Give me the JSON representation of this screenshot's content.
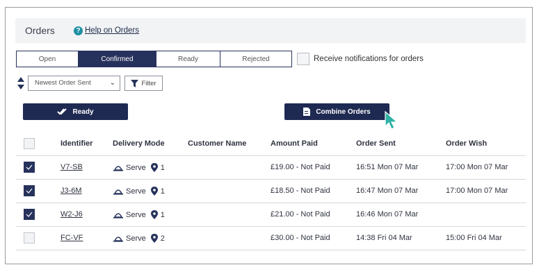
{
  "header": {
    "title": "Orders",
    "help_icon": "question-circle-icon",
    "help_link": "Help on Orders"
  },
  "tabs": [
    {
      "label": "Open",
      "active": false
    },
    {
      "label": "Confirmed",
      "active": true
    },
    {
      "label": "Ready",
      "active": false
    },
    {
      "label": "Rejected",
      "active": false
    }
  ],
  "notifications": {
    "label": "Receive notifications for orders",
    "checked": false
  },
  "sort": {
    "selected": "Newest Order Sent",
    "icon": "sort-arrows-icon"
  },
  "filter": {
    "label": "Filter",
    "icon": "funnel-icon"
  },
  "actions": {
    "ready_label": "Ready",
    "ready_icon": "double-check-icon",
    "combine_label": "Combine Orders",
    "combine_icon": "document-icon"
  },
  "table": {
    "columns": [
      "Identifier",
      "Delivery Mode",
      "Customer Name",
      "Amount Paid",
      "Order Sent",
      "Order Wish"
    ],
    "rows": [
      {
        "checked": true,
        "identifier": "V7-SB",
        "mode": "Serve",
        "table_no": "1",
        "customer": "",
        "amount": "£19.00 - Not Paid",
        "sent": "16:51 Mon 07 Mar",
        "wish": "17:00 Mon 07 Mar"
      },
      {
        "checked": true,
        "identifier": "J3-6M",
        "mode": "Serve",
        "table_no": "1",
        "customer": "",
        "amount": "£18.50 - Not Paid",
        "sent": "16:47 Mon 07 Mar",
        "wish": "17:00 Mon 07 Mar"
      },
      {
        "checked": true,
        "identifier": "W2-J6",
        "mode": "Serve",
        "table_no": "1",
        "customer": "",
        "amount": "£21.00 - Not Paid",
        "sent": "16:46 Mon 07 Mar",
        "wish": ""
      },
      {
        "checked": false,
        "identifier": "FC-VF",
        "mode": "Serve",
        "table_no": "2",
        "customer": "",
        "amount": "£30.00 - Not Paid",
        "sent": "14:38 Fri 04 Mar",
        "wish": "15:00 Fri 04 Mar"
      }
    ]
  },
  "colors": {
    "primary": "#27325c",
    "accent": "#1e8fa3",
    "cursor": "#2fb3a6"
  }
}
